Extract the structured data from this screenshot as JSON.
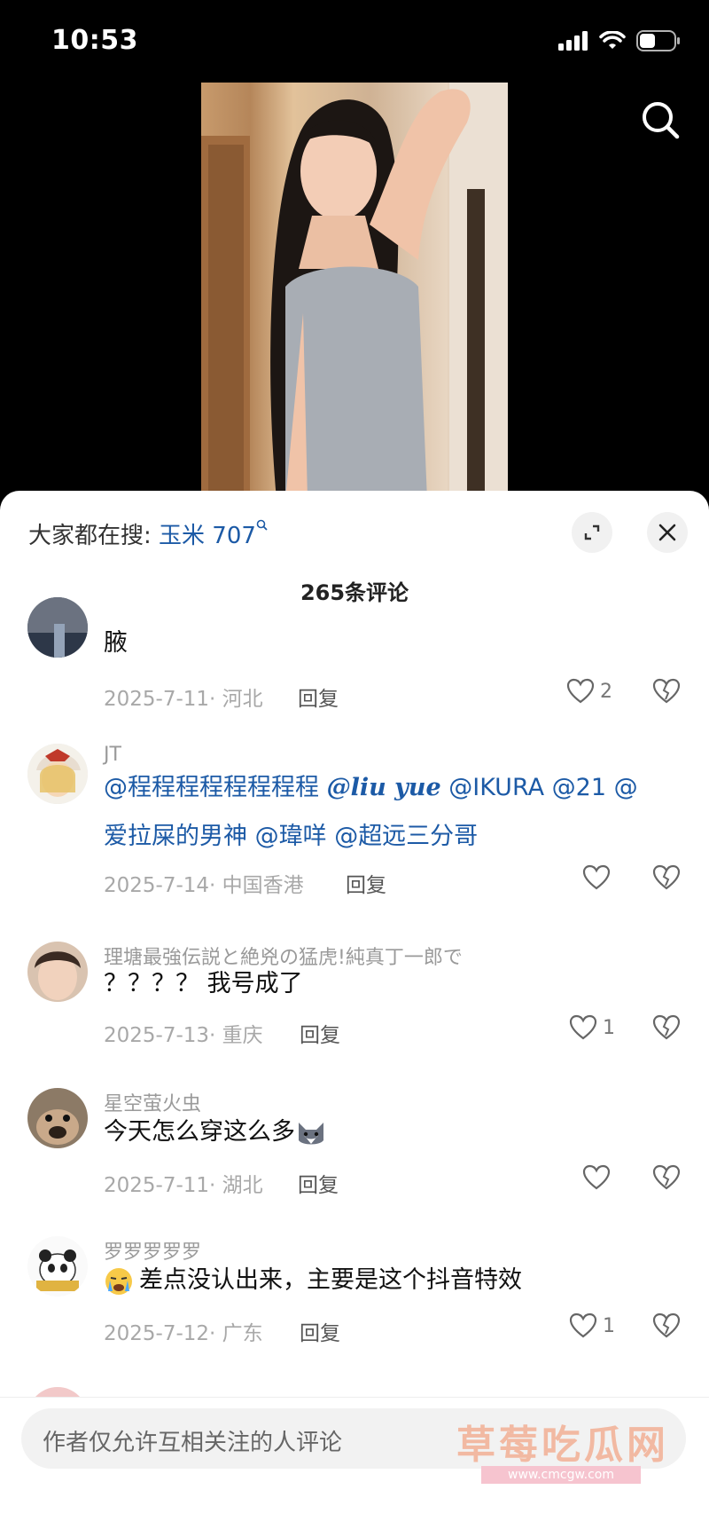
{
  "status": {
    "time": "10:53"
  },
  "search_bar": {
    "label": "大家都在搜: ",
    "keyword": "玉米 707"
  },
  "comments_count": "265条评论",
  "comments": [
    {
      "name": "",
      "text": "腋",
      "date_loc": "2025-7-11· 河北",
      "reply": "回复",
      "likes": "2"
    },
    {
      "name": "JT",
      "text_line1_parts": [
        "@程程程程程程程程",
        "@liu yue",
        "@IKURA",
        "@21",
        "@"
      ],
      "text_line2_parts": [
        "爱拉屎的男神",
        "@瑋咩",
        "@超远三分哥"
      ],
      "date_loc": "2025-7-14· 中国香港",
      "reply": "回复",
      "likes": ""
    },
    {
      "name": "理塘最強伝説と絶兇の猛虎!純真丁一郎で",
      "text": "？？？？ 我号成了",
      "date_loc": "2025-7-13· 重庆",
      "reply": "回复",
      "likes": "1"
    },
    {
      "name": "星空萤火虫",
      "text": "今天怎么穿这么多",
      "date_loc": "2025-7-11· 湖北",
      "reply": "回复",
      "likes": ""
    },
    {
      "name": "罗罗罗罗罗",
      "text": "差点没认出来，主要是这个抖音特效",
      "date_loc": "2025-7-12· 广东",
      "reply": "回复",
      "likes": "1"
    }
  ],
  "input": {
    "placeholder": "作者仅允许互相关注的人评论"
  },
  "watermark": {
    "text": "草莓吃瓜网",
    "url": "www.cmcgw.com"
  },
  "colors": {
    "accent": "#1c5aa6"
  }
}
